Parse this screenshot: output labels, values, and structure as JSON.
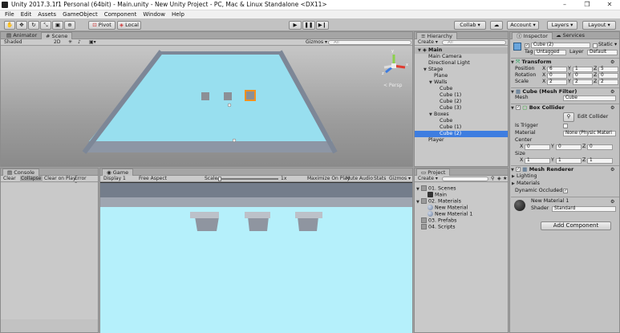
{
  "window": {
    "title": "Unity 2017.3.1f1 Personal (64bit) - Main.unity - New Unity Project - PC, Mac & Linux Standalone <DX11>",
    "minimize": "–",
    "maximize": "❐",
    "close": "✕"
  },
  "menu": [
    "File",
    "Edit",
    "Assets",
    "GameObject",
    "Component",
    "Window",
    "Help"
  ],
  "toolbar": {
    "pivot": "Pivot",
    "local": "Local",
    "collab": "Collab ▾",
    "account": "Account ▾",
    "layers": "Layers ▾",
    "layout": "Layout ▾"
  },
  "scene_panel": {
    "tabs": [
      "Animator",
      "Scene"
    ],
    "shaded": "Shaded",
    "mode2d": "2D",
    "gizmos": "Gizmos ▾",
    "search_placeholder": "All",
    "persp": "< Persp"
  },
  "hierarchy": {
    "tab": "Hierarchy",
    "create": "Create ▾",
    "search_placeholder": "All",
    "items": [
      {
        "label": "Main",
        "indent": 0,
        "arrow": "▼",
        "scene": true
      },
      {
        "label": "Main Camera",
        "indent": 1
      },
      {
        "label": "Directional Light",
        "indent": 1
      },
      {
        "label": "Stage",
        "indent": 1,
        "arrow": "▼"
      },
      {
        "label": "Plane",
        "indent": 2
      },
      {
        "label": "Walls",
        "indent": 2,
        "arrow": "▼"
      },
      {
        "label": "Cube",
        "indent": 3
      },
      {
        "label": "Cube (1)",
        "indent": 3
      },
      {
        "label": "Cube (2)",
        "indent": 3
      },
      {
        "label": "Cube (3)",
        "indent": 3
      },
      {
        "label": "Boxes",
        "indent": 2,
        "arrow": "▼"
      },
      {
        "label": "Cube",
        "indent": 3
      },
      {
        "label": "Cube (1)",
        "indent": 3
      },
      {
        "label": "Cube (2)",
        "indent": 3,
        "selected": true
      },
      {
        "label": "Player",
        "indent": 1
      }
    ]
  },
  "inspector": {
    "tabs": [
      "Inspector",
      "Services"
    ],
    "object_name": "Cube (2)",
    "static": "Static ▾",
    "tag_label": "Tag",
    "tag": "Untagged",
    "layer_label": "Layer",
    "layer": "Default",
    "transform": {
      "title": "Transform",
      "position_label": "Position",
      "position": [
        "6",
        "1",
        "5"
      ],
      "rotation_label": "Rotation",
      "rotation": [
        "0",
        "0",
        "0"
      ],
      "scale_label": "Scale",
      "scale": [
        "2",
        "2",
        "2"
      ]
    },
    "mesh_filter": {
      "title": "Cube (Mesh Filter)",
      "mesh_label": "Mesh",
      "mesh": "Cube"
    },
    "box_collider": {
      "title": "Box Collider",
      "edit": "Edit Collider",
      "trigger_label": "Is Trigger",
      "material_label": "Material",
      "material": "None (Physic Materi",
      "center_label": "Center",
      "center": [
        "0",
        "0",
        "0"
      ],
      "size_label": "Size",
      "size": [
        "1",
        "1",
        "1"
      ]
    },
    "renderer": {
      "title": "Mesh Renderer",
      "lighting": "Lighting",
      "materials": "Materials",
      "dynamic": "Dynamic Occluded"
    },
    "material": {
      "name": "New Material 1",
      "shader_label": "Shader",
      "shader": "Standard"
    },
    "add_component": "Add Component"
  },
  "console": {
    "tab": "Console",
    "buttons": [
      "Clear",
      "Collapse",
      "Clear on Play",
      "Error Pause"
    ]
  },
  "game": {
    "tab": "Game",
    "display": "Display 1",
    "aspect": "Free Aspect",
    "scale_label": "Scale",
    "scale_val": "1x",
    "buttons": [
      "Maximize On Play",
      "Mute Audio",
      "Stats",
      "Gizmos ▾"
    ]
  },
  "project": {
    "tab": "Project",
    "create": "Create ▾",
    "items": [
      {
        "label": "01. Scenes",
        "indent": 0,
        "arrow": "▼",
        "folder": true
      },
      {
        "label": "Main",
        "indent": 1,
        "unity": true
      },
      {
        "label": "02. Materials",
        "indent": 0,
        "arrow": "▼",
        "folder": true
      },
      {
        "label": "New Material",
        "indent": 1,
        "mat": true
      },
      {
        "label": "New Material 1",
        "indent": 1,
        "mat": true
      },
      {
        "label": "03. Prefabs",
        "indent": 0,
        "folder": true
      },
      {
        "label": "04. Scripts",
        "indent": 0,
        "folder": true
      }
    ]
  },
  "axis": {
    "x": "x",
    "y": "y",
    "z": "z"
  }
}
